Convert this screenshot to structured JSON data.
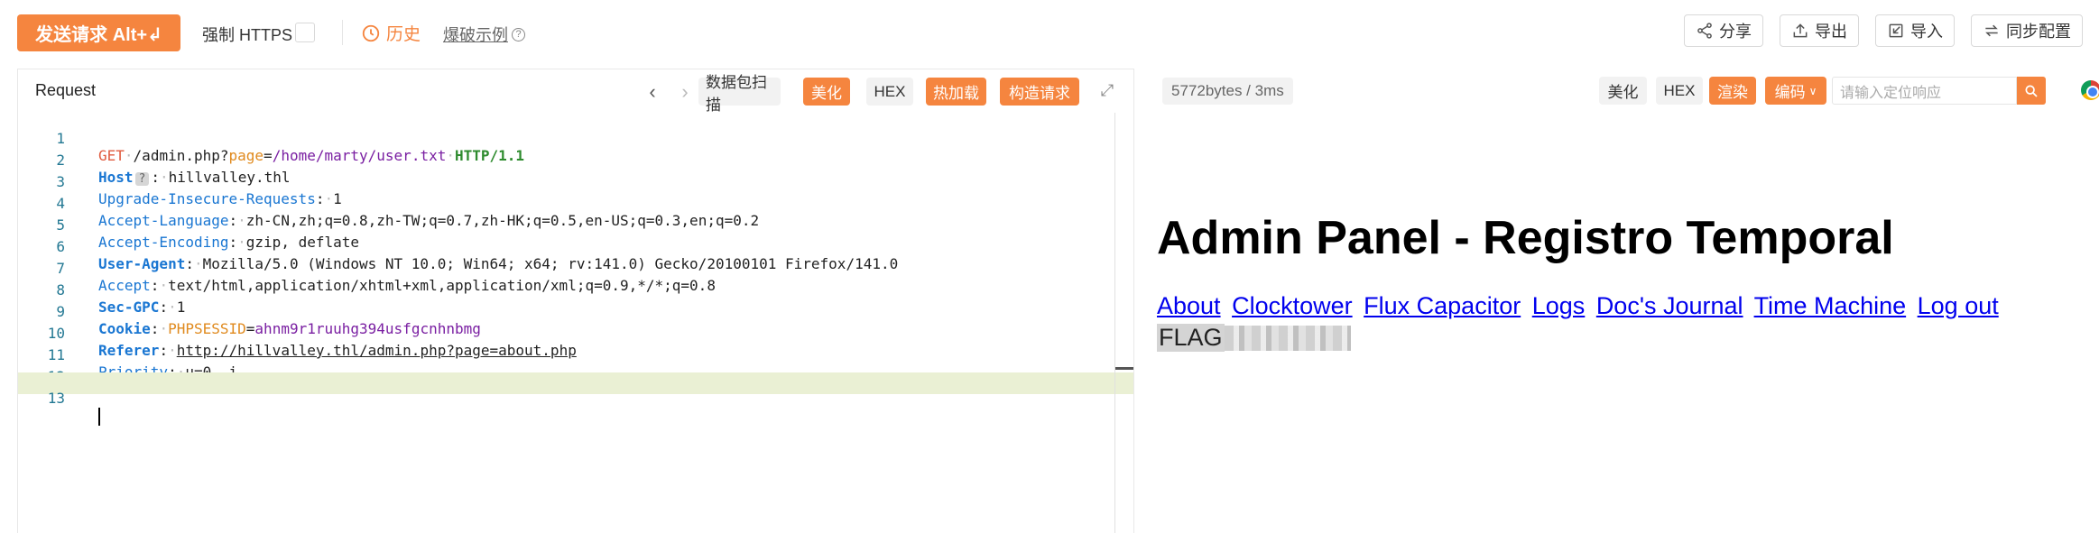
{
  "toolbar": {
    "send_label": "发送请求 Alt+↲",
    "https_label": "强制 HTTPS",
    "https_checked": false,
    "history_label": "历史",
    "examples_label": "爆破示例",
    "share_label": "分享",
    "export_label": "导出",
    "import_label": "导入",
    "sync_label": "同步配置"
  },
  "request": {
    "title": "Request",
    "buttons": {
      "scan": "数据包扫描",
      "beautify": "美化",
      "hex": "HEX",
      "hotload": "热加载",
      "construct": "构造请求"
    },
    "lines": [
      {
        "n": "1"
      },
      {
        "n": "2"
      },
      {
        "n": "3"
      },
      {
        "n": "4"
      },
      {
        "n": "5"
      },
      {
        "n": "6"
      },
      {
        "n": "7"
      },
      {
        "n": "8"
      },
      {
        "n": "9"
      },
      {
        "n": "10"
      },
      {
        "n": "11"
      },
      {
        "n": "12"
      },
      {
        "n": "13"
      }
    ],
    "method": "GET",
    "path_prefix": "/admin.php?",
    "param_key": "page",
    "param_val": "/home/marty/user.txt",
    "protocol": "HTTP/1.1",
    "host_key": "Host",
    "host_hint": "?",
    "host_val": "hillvalley.thl",
    "upgrade_key": "Upgrade-Insecure-Requests",
    "upgrade_val": "1",
    "lang_key": "Accept-Language",
    "lang_val": "zh-CN,zh;q=0.8,zh-TW;q=0.7,zh-HK;q=0.5,en-US;q=0.3,en;q=0.2",
    "enc_key": "Accept-Encoding",
    "enc_val": "gzip, deflate",
    "ua_key": "User-Agent",
    "ua_val": "Mozilla/5.0 (Windows NT 10.0; Win64; x64; rv:141.0) Gecko/20100101 Firefox/141.0",
    "accept_key": "Accept",
    "accept_val": "text/html,application/xhtml+xml,application/xml;q=0.9,*/*;q=0.8",
    "gpc_key": "Sec-GPC",
    "gpc_val": "1",
    "cookie_key": "Cookie",
    "cookie_name": "PHPSESSID",
    "cookie_val": "ahnm9r1ruuhg394usfgcnhnbmg",
    "referer_key": "Referer",
    "referer_val": "http://hillvalley.thl/admin.php?page=about.php",
    "priority_key": "Priority",
    "priority_val": "u=0, i"
  },
  "response": {
    "stats": "5772bytes / 3ms",
    "buttons": {
      "beautify": "美化",
      "hex": "HEX",
      "render": "渲染",
      "encoding": "编码"
    },
    "search_placeholder": "请输入定位响应",
    "page_title": "Admin Panel - Registro Temporal",
    "nav_links": [
      "About",
      "Clocktower",
      "Flux Capacitor",
      "Logs",
      "Doc's Journal",
      "Time Machine",
      "Log out"
    ],
    "flag_prefix": "FLAG"
  },
  "colors": {
    "accent": "#f5853f",
    "link": "#0000ee",
    "active_line": "#eaf0d4"
  }
}
